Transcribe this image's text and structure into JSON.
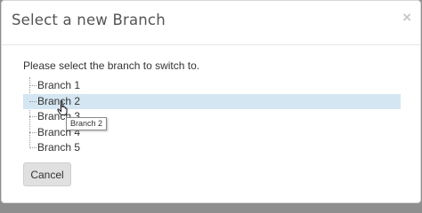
{
  "dialog": {
    "title": "Select a new Branch",
    "close_label": "×",
    "prompt": "Please select the branch to switch to.",
    "branches": [
      "Branch 1",
      "Branch 2",
      "Branch 3",
      "Branch 4",
      "Branch 5"
    ],
    "hovered_index": 1,
    "tooltip": "Branch 2",
    "cancel_label": "Cancel"
  },
  "colors": {
    "hover_background": "#d4e6f1",
    "button_background": "#e0e0e0",
    "backdrop": "#8e8e8e"
  }
}
